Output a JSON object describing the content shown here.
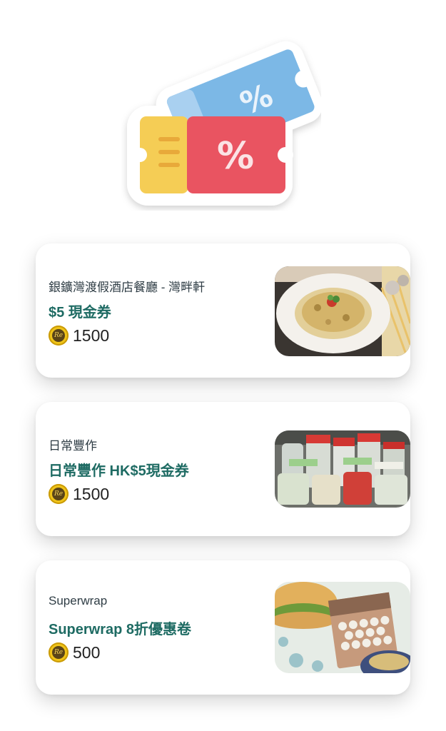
{
  "rewards": [
    {
      "merchant": "銀鑛灣渡假酒店餐廳 - 灣畔軒",
      "title": "$5 現金券",
      "points": "1500",
      "image": "pasta-dish-image"
    },
    {
      "merchant": "日常豐作",
      "title": "日常豐作 HK$5現金券",
      "points": "1500",
      "image": "jars-products-image"
    },
    {
      "merchant": "Superwrap",
      "title": "Superwrap 8折優惠卷",
      "points": "500",
      "image": "beeswax-wrap-image"
    }
  ],
  "coin_mark": "Re",
  "colors": {
    "title": "#1e6b63",
    "coupon_red": "#e95461",
    "coupon_blue": "#7cb8e6",
    "coupon_yellow": "#f5cd55",
    "coin": "#f0c419"
  }
}
